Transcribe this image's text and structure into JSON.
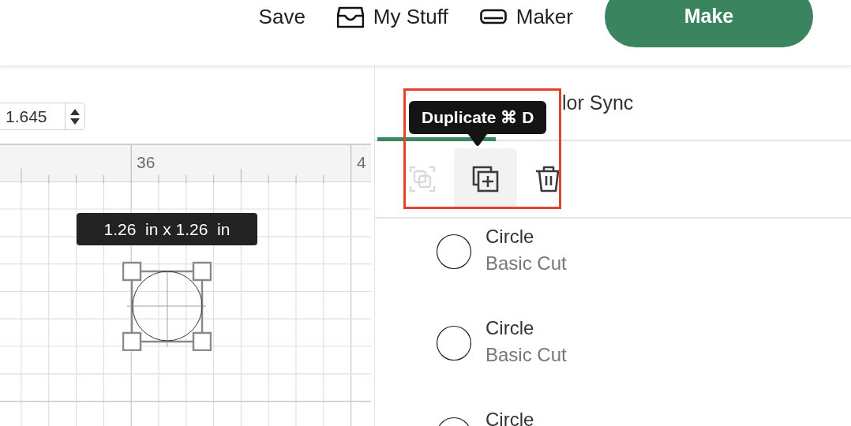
{
  "header": {
    "items": [
      {
        "label": "Save"
      },
      {
        "label": "My Stuff"
      },
      {
        "label": "Maker"
      }
    ],
    "make_button": "Make"
  },
  "canvas": {
    "field_value": "1.645",
    "ruler_labels": [
      "36",
      "4"
    ],
    "size_tooltip": "1.26  in x 1.26  in"
  },
  "panel": {
    "tabs": [
      {
        "selected": true
      },
      {
        "label": "lor Sync",
        "selected": false
      }
    ],
    "actions": [
      {
        "kind": "combine",
        "disabled": true,
        "hovered": false
      },
      {
        "kind": "duplicate",
        "disabled": false,
        "hovered": true
      },
      {
        "kind": "delete",
        "disabled": false,
        "hovered": false
      }
    ],
    "tooltip": "Duplicate ⌘ D",
    "highlight_frame": true,
    "layers": [
      {
        "name": "Circle",
        "operation": "Basic Cut"
      },
      {
        "name": "Circle",
        "operation": "Basic Cut"
      },
      {
        "name": "Circle"
      }
    ]
  }
}
